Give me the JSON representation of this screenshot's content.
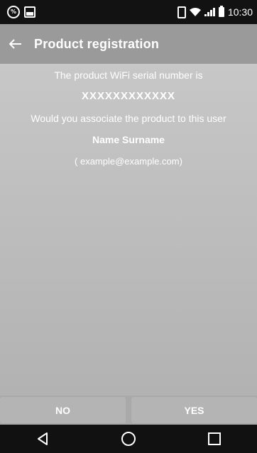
{
  "status_bar": {
    "time": "10:30",
    "icons": [
      "percent-icon",
      "image-icon",
      "vibrate-icon",
      "wifi-icon",
      "signal-icon",
      "battery-icon"
    ]
  },
  "app_bar": {
    "title": "Product registration",
    "back_icon": "arrow-left-icon"
  },
  "content": {
    "line1": "The product WiFi serial number is",
    "serial": "XXXXXXXXXXXX",
    "question": "Would you associate the product to this user",
    "user_name": "Name Surname",
    "user_email": "( example@example.com)"
  },
  "buttons": {
    "no": "NO",
    "yes": "YES"
  },
  "nav_bar": {
    "back": "triangle-back-icon",
    "home": "circle-home-icon",
    "recents": "square-recents-icon"
  },
  "colors": {
    "app_bar": "#9a9a9a",
    "content_bg": "#c2c2c2",
    "text": "#ffffff",
    "system_bars": "#111111"
  }
}
